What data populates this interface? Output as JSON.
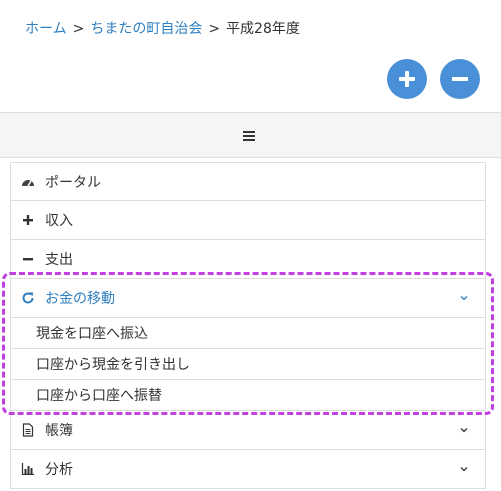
{
  "breadcrumb": {
    "home": "ホーム",
    "association": "ちまたの町自治会",
    "current": "平成28年度",
    "separator": ">"
  },
  "zoom": {
    "in_icon": "plus-icon",
    "out_icon": "minus-icon"
  },
  "menubar": {
    "toggle_icon": "hamburger-icon"
  },
  "nav": {
    "portal": "ポータル",
    "income": "収入",
    "expense": "支出",
    "transfer": "お金の移動",
    "transfer_sub": [
      "現金を口座へ振込",
      "口座から現金を引き出し",
      "口座から口座へ振替"
    ],
    "ledger": "帳簿",
    "analysis": "分析"
  },
  "colors": {
    "link": "#2f7fc1",
    "button": "#4a90d9",
    "highlight": "#c040e0"
  }
}
